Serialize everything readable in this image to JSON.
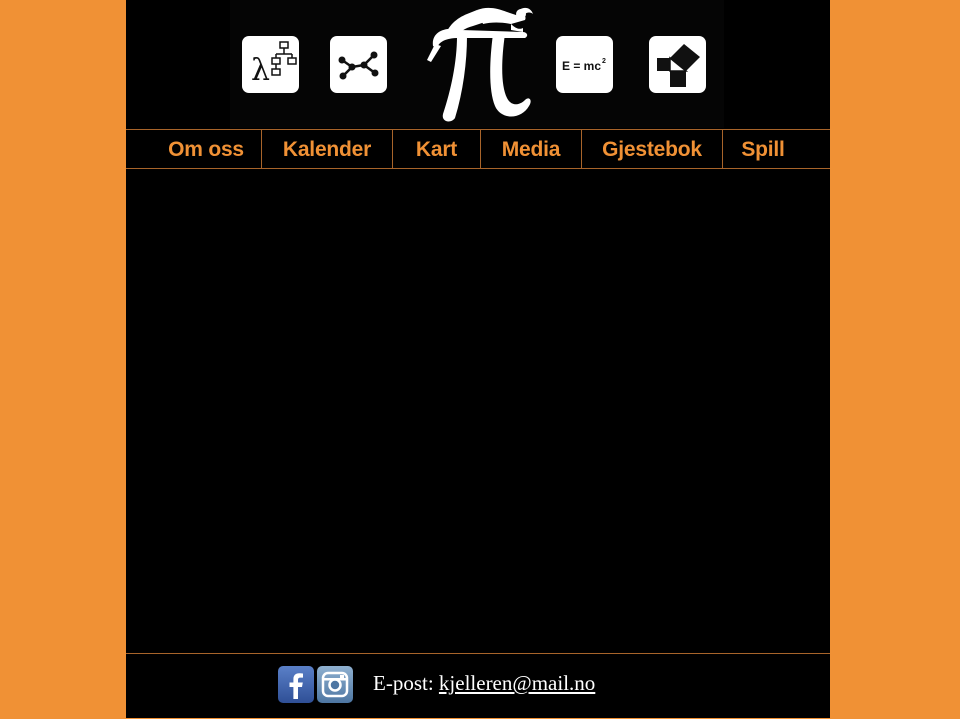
{
  "colors": {
    "background": "#f09135",
    "page": "#000000",
    "nav_text": "#f09135",
    "divider": "#a8642a"
  },
  "header": {
    "icons": [
      "lambda-flowchart-icon",
      "graph-network-icon",
      "pi-logo-icon",
      "emc2-icon",
      "pythagoras-icon"
    ],
    "emc_text": "E = mc"
  },
  "nav": {
    "items": [
      {
        "label": "Om oss"
      },
      {
        "label": "Kalender"
      },
      {
        "label": "Kart"
      },
      {
        "label": "Media"
      },
      {
        "label": "Gjestebok"
      },
      {
        "label": "Spill"
      }
    ]
  },
  "footer": {
    "social_icons": [
      "facebook-icon",
      "instagram-icon"
    ],
    "email_label": "E-post:",
    "email_address": "kjelleren@mail.no"
  }
}
